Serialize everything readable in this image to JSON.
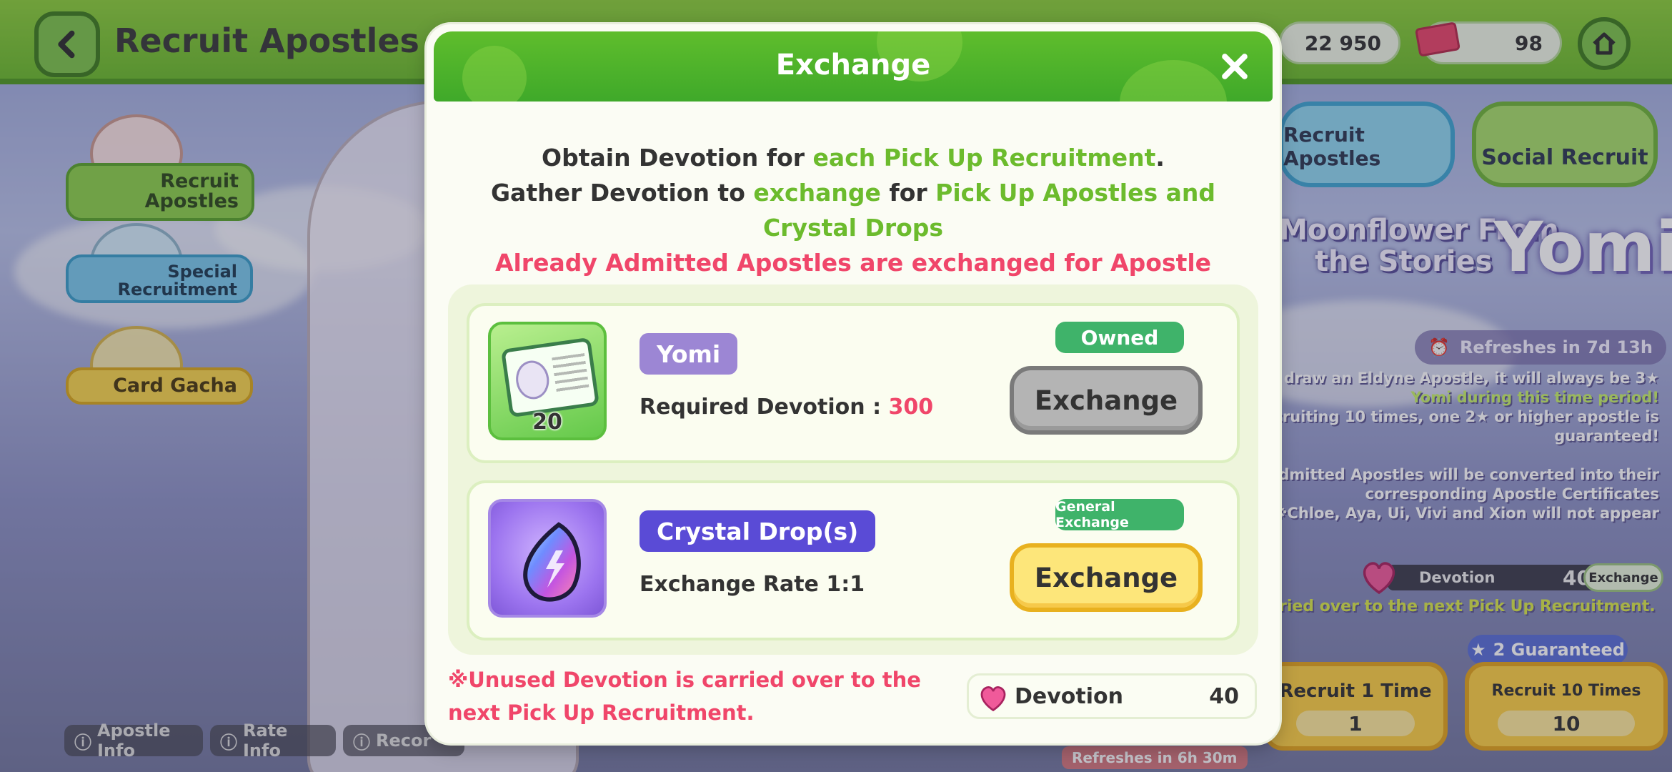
{
  "background": {
    "screen_title": "Recruit Apostles",
    "currency_1": "22 950",
    "tickets": "98",
    "side_menu": [
      "Recruit Apostles",
      "Special Recruitment",
      "Card Gacha"
    ],
    "tabs": [
      "Recruit Apostles",
      "Social Recruit"
    ],
    "banner_line1": "Moonflower From",
    "banner_line2": "the Stories",
    "banner_name": "Yomi",
    "refresh_label": "Refreshes in 7d 13h",
    "info_lines": [
      "u draw an Eldyne Apostle, it will always be 3★",
      "Yomi during this time period!",
      "ecruiting 10 times, one 2★ or higher apostle is",
      "guaranteed!",
      "",
      "admitted Apostles will be converted into their",
      "corresponding Apostle Certificates",
      "※Chloe, Aya, Ui, Vivi and Xion will not appear"
    ],
    "devotion_label": "Devotion",
    "devotion_value": "40",
    "devotion_exchange": "Exchange",
    "carry_note": "ried over to the next Pick Up Recruitment.",
    "guaranteed_label": "2 Guaranteed",
    "recruit_1_label": "Recruit 1 Time",
    "recruit_1_cost": "1",
    "recruit_10_label": "Recruit 10 Times",
    "recruit_10_cost": "10",
    "refresh_small": "Refreshes in 6h 30m",
    "bottom_tabs": [
      "Apostle Info",
      "Rate Info",
      "Recor"
    ]
  },
  "modal": {
    "title": "Exchange",
    "desc": {
      "l1_a": "Obtain Devotion for ",
      "l1_b": "each Pick Up Recruitment",
      "l1_c": ".",
      "l2_a": "Gather Devotion to ",
      "l2_b": "exchange",
      "l2_c": " for ",
      "l2_d": "Pick Up Apostles and Crystal Drops",
      "l3": "Already Admitted Apostles are exchanged for Apostle Certificates."
    },
    "items": [
      {
        "name": "Yomi",
        "icon": "apostle-card-icon",
        "count": "20",
        "sub_label": "Required Devotion : ",
        "sub_value": "300",
        "tag": "Owned",
        "button": "Exchange",
        "button_state": "disabled"
      },
      {
        "name": "Crystal Drop(s)",
        "icon": "crystal-drop-icon",
        "sub_label": "Exchange Rate 1:1",
        "tag": "General Exchange",
        "button": "Exchange",
        "button_state": "active"
      }
    ],
    "footer_note": "※Unused Devotion is carried over to the next Pick Up Recruitment.",
    "devotion_label": "Devotion",
    "devotion_value": "40"
  },
  "colors": {
    "header_green": "#3fa92a",
    "highlight_green": "#6cbb2d",
    "highlight_red": "#f0466a",
    "owned_tag": "#3fb36a",
    "yomi_badge": "#9c86d4",
    "crystal_badge": "#5a4bd6",
    "active_button": "#fde67a",
    "disabled_button": "#b4b4b4"
  }
}
